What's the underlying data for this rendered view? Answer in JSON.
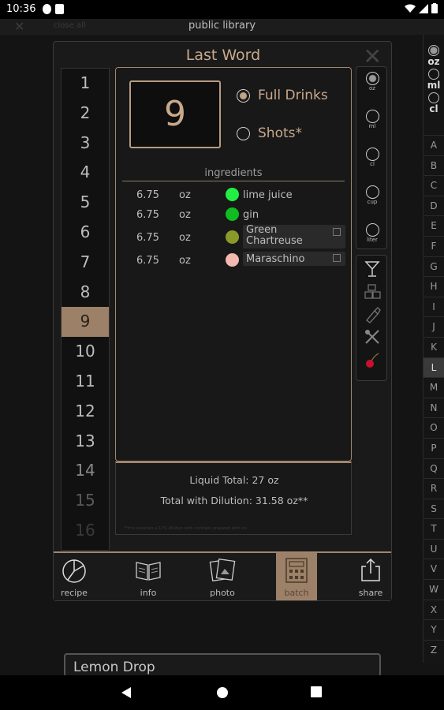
{
  "status": {
    "time": "10:36"
  },
  "appbar": {
    "close_all": "close all",
    "title": "public library"
  },
  "modal": {
    "title": "Last Word",
    "selected_count": "9",
    "numbers": [
      "1",
      "2",
      "3",
      "4",
      "5",
      "6",
      "7",
      "8",
      "9",
      "10",
      "11",
      "12",
      "13",
      "14",
      "15",
      "16"
    ],
    "selected_number": "9",
    "options": {
      "full_drinks": "Full Drinks",
      "shots": "Shots*"
    },
    "ingredients_header": "ingredients",
    "ingredients": [
      {
        "amount": "6.75",
        "unit": "oz",
        "name": "lime juice",
        "color": "#22ee44"
      },
      {
        "amount": "6.75",
        "unit": "oz",
        "name": "gin",
        "color": "#11bb22"
      },
      {
        "amount": "6.75",
        "unit": "oz",
        "name": "Green Chartreuse",
        "color": "#8a9a2a"
      },
      {
        "amount": "6.75",
        "unit": "oz",
        "name": "Maraschino",
        "color": "#f3b8b0"
      }
    ],
    "totals": {
      "liquid": "Liquid Total: 27 oz",
      "dilution": "Total with Dilution: 31.58 oz**",
      "fine_print": "**this assumes a 17% dilution with cocktails prepared with ice"
    },
    "units": [
      "oz",
      "ml",
      "cl",
      "cup",
      "liter"
    ],
    "selected_unit": "oz"
  },
  "nav": [
    {
      "label": "recipe",
      "icon": "recipe-icon"
    },
    {
      "label": "info",
      "icon": "book-icon"
    },
    {
      "label": "photo",
      "icon": "photo-icon"
    },
    {
      "label": "batch",
      "icon": "calculator-icon"
    },
    {
      "label": "share",
      "icon": "share-icon"
    }
  ],
  "alphabet": {
    "units": [
      "oz",
      "ml",
      "cl"
    ],
    "letters": [
      "A",
      "B",
      "C",
      "D",
      "E",
      "F",
      "G",
      "H",
      "I",
      "J",
      "K",
      "L",
      "M",
      "N",
      "O",
      "P",
      "Q",
      "R",
      "S",
      "T",
      "U",
      "V",
      "W",
      "X",
      "Y",
      "Z"
    ],
    "selected": "L"
  },
  "card": {
    "title": "Lemon Drop"
  }
}
